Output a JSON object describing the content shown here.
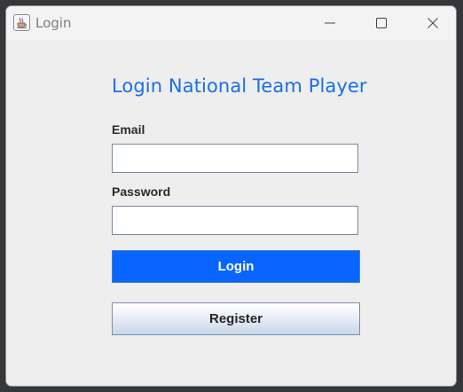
{
  "window": {
    "title": "Login",
    "icon": "java-cup-icon"
  },
  "controls": {
    "minimize": "minimize-icon",
    "maximize": "maximize-icon",
    "close": "close-icon"
  },
  "form": {
    "heading": "Login National Team Player",
    "email_label": "Email",
    "email_value": "",
    "password_label": "Password",
    "password_value": "",
    "login_label": "Login",
    "register_label": "Register"
  },
  "colors": {
    "heading": "#1a6fe6",
    "login_button": "#0865ff",
    "window_background": "#eeeeee"
  }
}
